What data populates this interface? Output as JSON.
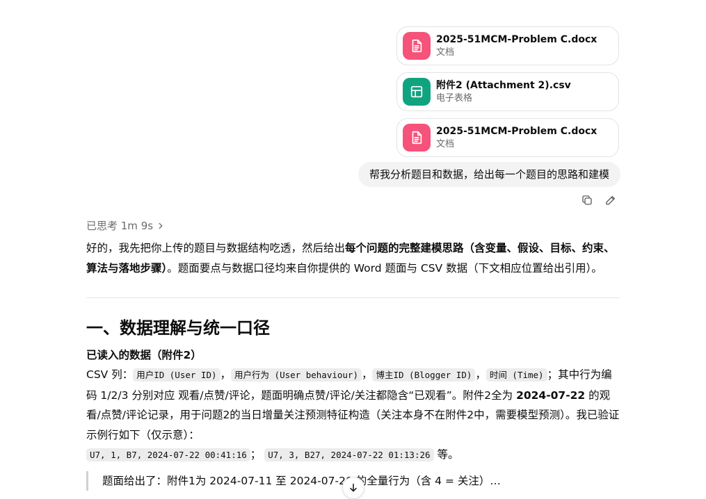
{
  "colors": {
    "doc_icon": "#f5537a",
    "sheet_icon": "#10a37f"
  },
  "attachments": [
    {
      "name": "2025-51MCM-Problem C.docx",
      "type": "文档",
      "icon": "document-icon"
    },
    {
      "name": "附件2 (Attachment 2).csv",
      "type": "电子表格",
      "icon": "spreadsheet-icon"
    },
    {
      "name": "2025-51MCM-Problem C.docx",
      "type": "文档",
      "icon": "document-icon"
    }
  ],
  "user_message": "帮我分析题目和数据，给出每一个题目的思路和建模",
  "thought": "已思考 1m 9s",
  "intro": {
    "t1": "好的，我先把你上传的题目与数据结构吃透，然后给出",
    "b1": "每个问题的完整建模思路（含变量、假设、目标、约束、算法与落地步骤）",
    "t2": "。题面要点与数据口径均来自你提供的 Word 题面与 CSV 数据（下文相应位置给出引用）。"
  },
  "section1": {
    "title": "一、数据理解与统一口径",
    "subtitle": "已读入的数据（附件2）",
    "csv_label": "CSV 列：",
    "columns": [
      "用户ID (User ID)",
      "用户行为 (User behaviour)",
      "博主ID (Blogger ID)",
      "时间 (Time)"
    ],
    "sep": "，",
    "p1": "；其中行为编码 1/2/3 分别对应 观看/点赞/评论，题面明确点赞/评论/关注都隐含“已观看”。附件2全为 ",
    "date": "2024-07-22",
    "p2": " 的观看/点赞/评论记录，用于问题2的当日增量关注预测特征构造（关注本身不在附件2中，需要模型预测）。我已验证示例行如下（仅示意）：",
    "example1": "U7, 1, B7, 2024-07-22 00:41:16",
    "example_sep": "；",
    "example2": "U7, 3, B27, 2024-07-22 01:13:26",
    "example_end": "等。",
    "quote_partial": "  题面给出了：附件1为 2024-07-11 至 2024-07-20 的全量行为（含 4 = 关注）…"
  }
}
